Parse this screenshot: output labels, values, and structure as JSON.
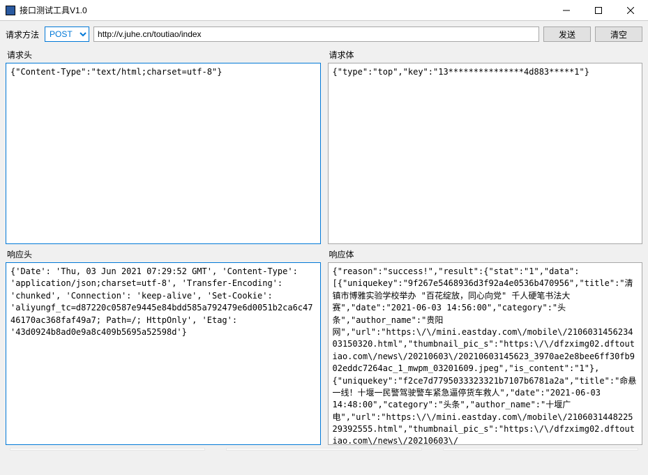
{
  "window": {
    "title": "接口测试工具V1.0"
  },
  "toolbar": {
    "method_label": "请求方法",
    "method_value": "POST",
    "url_value": "http://v.juhe.cn/toutiao/index",
    "send_label": "发送",
    "clear_label": "清空"
  },
  "panels": {
    "req_header_label": "请求头",
    "req_body_label": "请求体",
    "res_header_label": "响应头",
    "res_body_label": "响应体"
  },
  "data": {
    "req_header": "{\"Content-Type\":\"text/html;charset=utf-8\"}",
    "req_body": "{\"type\":\"top\",\"key\":\"13***************4d883*****1\"}",
    "res_header": "{'Date': 'Thu, 03 Jun 2021 07:29:52 GMT', 'Content-Type': 'application/json;charset=utf-8', 'Transfer-Encoding': 'chunked', 'Connection': 'keep-alive', 'Set-Cookie': 'aliyungf_tc=d87220c0587e9445e84bdd585a792479e6d0051b2ca6c4746170ac368faf49a7; Path=/; HttpOnly', 'Etag': '43d0924b8ad0e9a8c409b5695a52598d'}",
    "res_body": "{\"reason\":\"success!\",\"result\":{\"stat\":\"1\",\"data\":[{\"uniquekey\":\"9f267e5468936d3f92a4e0536b470956\",\"title\":\"清镇市博雅实验学校举办 \"百花绽放，同心向党\" 千人硬笔书法大赛\",\"date\":\"2021-06-03 14:56:00\",\"category\":\"头条\",\"author_name\":\"贵阳网\",\"url\":\"https:\\/\\/mini.eastday.com\\/mobile\\/210603145623403150320.html\",\"thumbnail_pic_s\":\"https:\\/\\/dfzximg02.dftoutiao.com\\/news\\/20210603\\/20210603145623_3970ae2e8bee6ff30fb902eddc7264ac_1_mwpm_03201609.jpeg\",\"is_content\":\"1\"},{\"uniquekey\":\"f2ce7d7795033323321b7107b6781a2a\",\"title\":\"命悬一线！十堰一民警驾驶警车紧急逼停货车救人\",\"date\":\"2021-06-03 14:48:00\",\"category\":\"头条\",\"author_name\":\"十堰广电\",\"url\":\"https:\\/\\/mini.eastday.com\\/mobile\\/210603144822529392555.html\",\"thumbnail_pic_s\":\"https:\\/\\/dfzximg02.dftoutiao.com\\/news\\/20210603\\/"
  }
}
